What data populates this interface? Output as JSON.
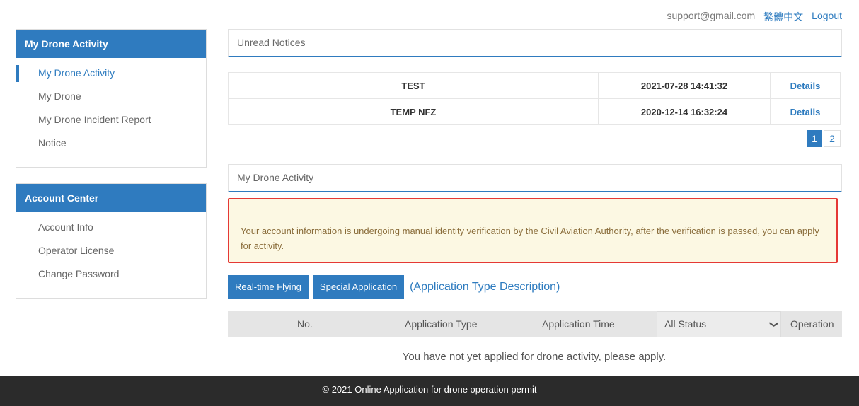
{
  "top": {
    "email": "support@gmail.com",
    "language": "繁體中文",
    "logout": "Logout"
  },
  "sidebar": {
    "activity_panel": {
      "title": "My Drone Activity",
      "items": [
        {
          "label": "My Drone Activity",
          "active": true
        },
        {
          "label": "My Drone"
        },
        {
          "label": "My Drone Incident Report"
        },
        {
          "label": "Notice"
        }
      ]
    },
    "account_panel": {
      "title": "Account Center",
      "items": [
        {
          "label": "Account Info"
        },
        {
          "label": "Operator License"
        },
        {
          "label": "Change Password"
        }
      ]
    }
  },
  "notices": {
    "title": "Unread Notices",
    "rows": [
      {
        "title": "TEST",
        "time": "2021-07-28 14:41:32",
        "link": "Details"
      },
      {
        "title": "TEMP NFZ",
        "time": "2020-12-14 16:32:24",
        "link": "Details"
      }
    ],
    "pages": [
      "1",
      "2"
    ],
    "current_page": "1"
  },
  "activity": {
    "title": "My Drone Activity",
    "alert": "Your account information is undergoing manual identity verification by the Civil Aviation Authority, after the verification is passed, you can apply for activity.",
    "buttons": {
      "realtime": "Real-time Flying",
      "special": "Special Application"
    },
    "type_description_link": "(Application Type Description)",
    "table": {
      "columns": {
        "no": "No.",
        "type": "Application Type",
        "time": "Application Time",
        "status": "All Status",
        "operation": "Operation"
      },
      "empty_message": "You have not yet applied for drone activity, please apply."
    }
  },
  "footer": {
    "text": "© 2021 Online Application for drone operation permit"
  },
  "colors": {
    "accent": "#2f7bbf",
    "alert_border": "#e53935",
    "alert_bg": "#fcf8e3",
    "footer_bg": "#2b2b2b"
  }
}
